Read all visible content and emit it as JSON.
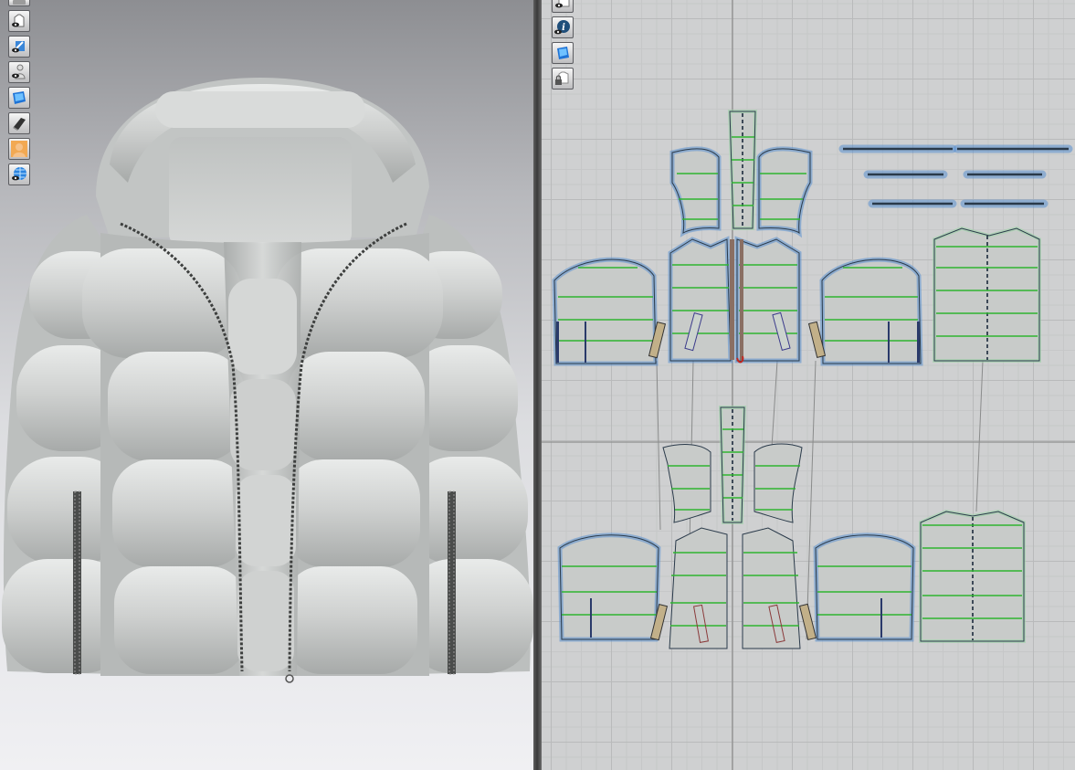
{
  "viewport3d": {
    "toolbar": [
      {
        "icon": "partial-button-icon"
      },
      {
        "icon": "show-garment-icon"
      },
      {
        "icon": "show-texture-icon"
      },
      {
        "icon": "show-avatar-icon"
      },
      {
        "icon": "fabric-render-icon"
      },
      {
        "icon": "thickness-render-icon"
      },
      {
        "icon": "avatar-skin-icon"
      },
      {
        "icon": "environment-globe-icon"
      }
    ],
    "background_top": "#8d8e92",
    "background_bottom": "#f0f0f3",
    "garment_color": "#c9cbca"
  },
  "pattern2d": {
    "toolbar": [
      {
        "icon": "show-2d-pattern-icon"
      },
      {
        "icon": "pattern-info-icon"
      },
      {
        "icon": "fabric-texture-2d-icon"
      },
      {
        "icon": "lock-garment-icon"
      }
    ],
    "colors": {
      "grid": "#b9babb",
      "piece_fill": "#c8cbc9",
      "selection_outline": "#5a8fd0",
      "internal_line": "#2fb530",
      "center_line": "#1b2b3c",
      "rib": "#c2b089"
    }
  }
}
